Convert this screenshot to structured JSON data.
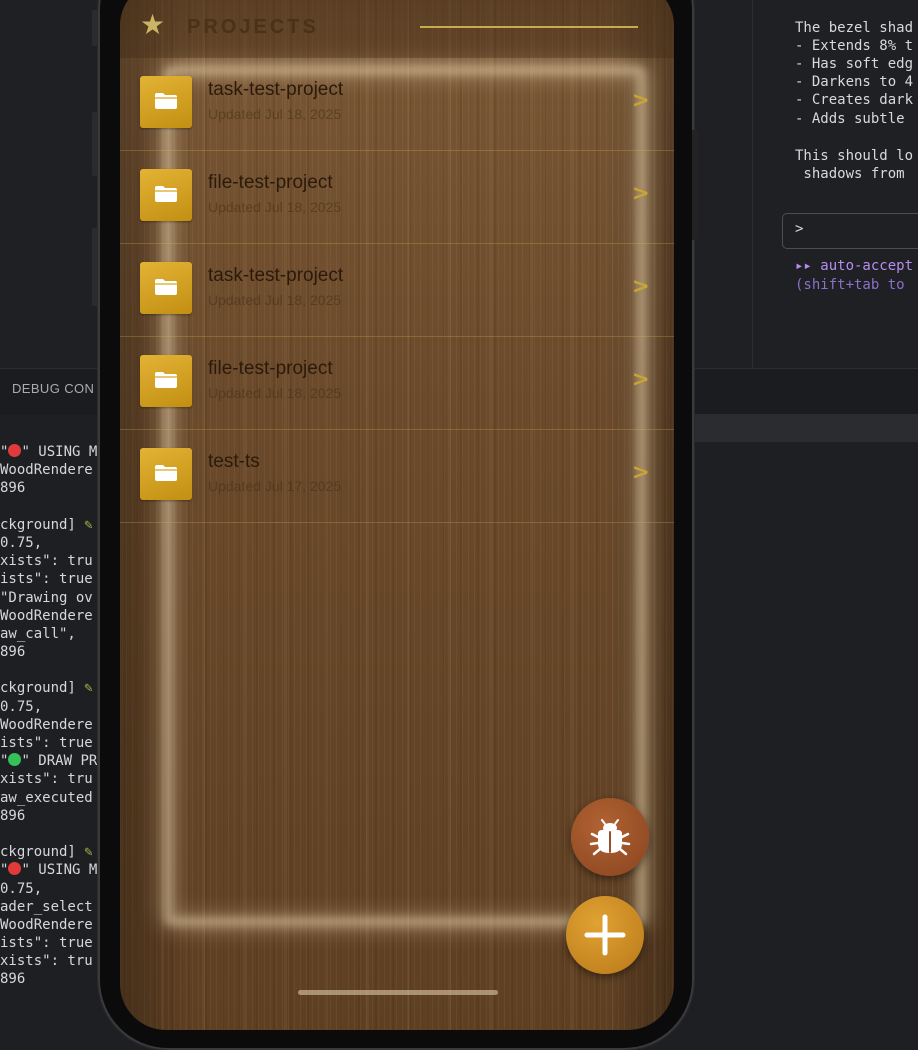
{
  "debug_panel": {
    "tab_label": "DEBUG CON",
    "console_lines": [
      {
        "dot": "red",
        "text": "\" USING M",
        "prefix": ""
      },
      {
        "text": "WoodRendere"
      },
      {
        "text": "896"
      },
      {
        "text": ""
      },
      {
        "text": "ckground] ",
        "pencil": true
      },
      {
        "text": "0.75,"
      },
      {
        "text": "xists\": tru"
      },
      {
        "text": "ists\": true"
      },
      {
        "text": "\"Drawing ov"
      },
      {
        "text": "WoodRendere"
      },
      {
        "text": "aw_call\","
      },
      {
        "text": "896"
      },
      {
        "text": ""
      },
      {
        "text": "ckground] ",
        "pencil": true
      },
      {
        "text": "0.75,"
      },
      {
        "text": "WoodRendere"
      },
      {
        "text": "ists\": true"
      },
      {
        "dot": "green",
        "text": "\" DRAW PR"
      },
      {
        "text": "xists\": tru"
      },
      {
        "text": "aw_executed"
      },
      {
        "text": "896"
      },
      {
        "text": ""
      },
      {
        "text": "ckground] ",
        "pencil": true
      },
      {
        "dot": "red",
        "text": "\" USING M"
      },
      {
        "text": "0.75,"
      },
      {
        "text": "ader_select"
      },
      {
        "text": "WoodRendere"
      },
      {
        "text": "ists\": true"
      },
      {
        "text": "xists\": tru"
      },
      {
        "text": "896"
      }
    ]
  },
  "terminal": {
    "lines": [
      {
        "text": "The bezel shad"
      },
      {
        "text": "- Extends 8% t"
      },
      {
        "text": "- Has soft edg"
      },
      {
        "text": "- Darkens to 4"
      },
      {
        "text": "- Creates dark"
      },
      {
        "text": "- Adds subtle "
      },
      {
        "text": "This should lo"
      },
      {
        "text": " shadows from "
      }
    ],
    "prompt_char": ">",
    "mode_line": "▸▸ auto-accept",
    "mode_hint": "(shift+tab to "
  },
  "app": {
    "header": {
      "title": "PROJECTS",
      "star_icon": "★"
    },
    "projects": [
      {
        "name": "task-test-project",
        "updated": "Updated Jul 18, 2025"
      },
      {
        "name": "file-test-project",
        "updated": "Updated Jul 18, 2025"
      },
      {
        "name": "task-test-project",
        "updated": "Updated Jul 18, 2025"
      },
      {
        "name": "file-test-project",
        "updated": "Updated Jul 18, 2025"
      },
      {
        "name": "test-ts",
        "updated": "Updated Jul 17, 2025"
      }
    ],
    "chevron": ">",
    "colors": {
      "accent_gold": "#c9a534",
      "folder_gold": "#d8a624",
      "bug_button": "#9a4f27",
      "add_button": "#cf8d22"
    }
  }
}
